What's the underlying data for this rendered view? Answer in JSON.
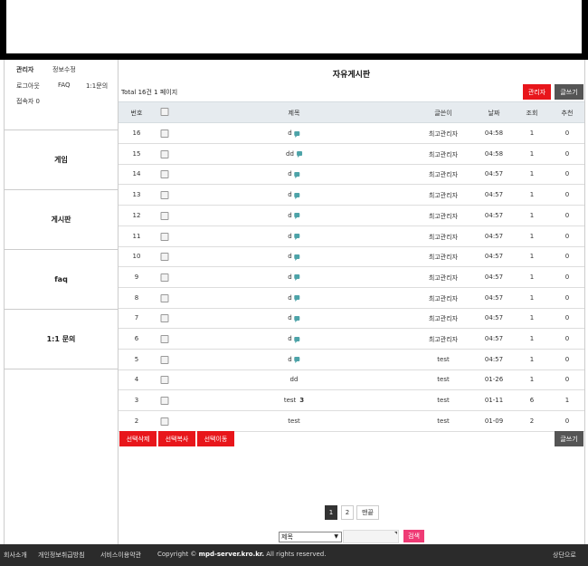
{
  "sidebar": {
    "admin_label": "관리자",
    "edit_info": "정보수정",
    "logout": "로그아웃",
    "faq": "FAQ",
    "inquiry": "1:1문의",
    "visitors": "접속자 0",
    "menu": [
      "게임",
      "게시판",
      "faq",
      "1:1 문의"
    ]
  },
  "board": {
    "title": "자유게시판",
    "total": "Total 16건 1 페이지",
    "admin_button": "관리자",
    "write_button": "글쓰기",
    "columns": {
      "no": "번호",
      "subject": "제목",
      "writer": "글쓴이",
      "date": "날짜",
      "views": "조회",
      "recommend": "추천"
    },
    "rows": [
      {
        "no": "16",
        "subject": "d",
        "comment": true,
        "comment_count": "",
        "writer": "최고관리자",
        "date": "04:58",
        "views": "1",
        "recommend": "0"
      },
      {
        "no": "15",
        "subject": "dd",
        "comment": true,
        "comment_count": "",
        "writer": "최고관리자",
        "date": "04:58",
        "views": "1",
        "recommend": "0"
      },
      {
        "no": "14",
        "subject": "d",
        "comment": true,
        "comment_count": "",
        "writer": "최고관리자",
        "date": "04:57",
        "views": "1",
        "recommend": "0"
      },
      {
        "no": "13",
        "subject": "d",
        "comment": true,
        "comment_count": "",
        "writer": "최고관리자",
        "date": "04:57",
        "views": "1",
        "recommend": "0"
      },
      {
        "no": "12",
        "subject": "d",
        "comment": true,
        "comment_count": "",
        "writer": "최고관리자",
        "date": "04:57",
        "views": "1",
        "recommend": "0"
      },
      {
        "no": "11",
        "subject": "d",
        "comment": true,
        "comment_count": "",
        "writer": "최고관리자",
        "date": "04:57",
        "views": "1",
        "recommend": "0"
      },
      {
        "no": "10",
        "subject": "d",
        "comment": true,
        "comment_count": "",
        "writer": "최고관리자",
        "date": "04:57",
        "views": "1",
        "recommend": "0"
      },
      {
        "no": "9",
        "subject": "d",
        "comment": true,
        "comment_count": "",
        "writer": "최고관리자",
        "date": "04:57",
        "views": "1",
        "recommend": "0"
      },
      {
        "no": "8",
        "subject": "d",
        "comment": true,
        "comment_count": "",
        "writer": "최고관리자",
        "date": "04:57",
        "views": "1",
        "recommend": "0"
      },
      {
        "no": "7",
        "subject": "d",
        "comment": true,
        "comment_count": "",
        "writer": "최고관리자",
        "date": "04:57",
        "views": "1",
        "recommend": "0"
      },
      {
        "no": "6",
        "subject": "d",
        "comment": true,
        "comment_count": "",
        "writer": "최고관리자",
        "date": "04:57",
        "views": "1",
        "recommend": "0"
      },
      {
        "no": "5",
        "subject": "d",
        "comment": true,
        "comment_count": "",
        "writer": "test",
        "date": "04:57",
        "views": "1",
        "recommend": "0"
      },
      {
        "no": "4",
        "subject": "dd",
        "comment": false,
        "comment_count": "",
        "writer": "test",
        "date": "01-26",
        "views": "1",
        "recommend": "0"
      },
      {
        "no": "3",
        "subject": "test",
        "comment": false,
        "comment_count": "3",
        "writer": "test",
        "date": "01-11",
        "views": "6",
        "recommend": "1"
      },
      {
        "no": "2",
        "subject": "test",
        "comment": false,
        "comment_count": "",
        "writer": "test",
        "date": "01-09",
        "views": "2",
        "recommend": "0"
      }
    ],
    "bottom_buttons": {
      "delete_selected": "선택삭제",
      "copy_selected": "선택복사",
      "move_selected": "선택이동",
      "write": "글쓰기"
    }
  },
  "pagination": {
    "pages": [
      "1",
      "2"
    ],
    "current": "1",
    "end": "맨끝"
  },
  "search": {
    "field_selected": "제목",
    "button": "검색"
  },
  "footer": {
    "company": "회사소개",
    "privacy": "개인정보취급방침",
    "terms": "서비스이용약관",
    "copyright_prefix": "Copyright ©",
    "domain": "mpd-server.kro.kr.",
    "copyright_suffix": "All rights reserved.",
    "top": "상단으로"
  },
  "colors": {
    "primary_red": "#e8161b",
    "search_pink": "#ef3b75",
    "dark_button": "#555555",
    "comment_icon": "#4da3a8",
    "footer_bg": "#2b2b2b"
  }
}
